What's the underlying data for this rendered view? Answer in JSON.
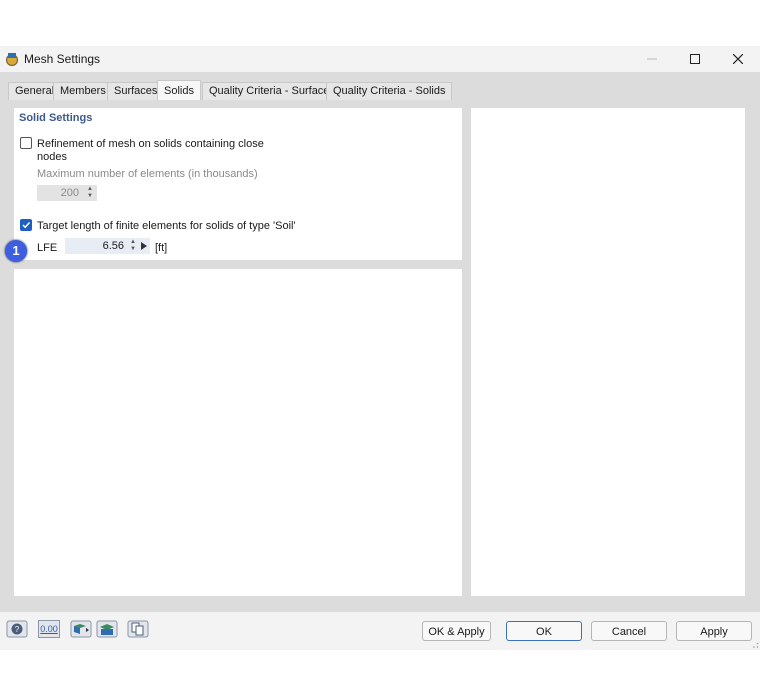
{
  "window": {
    "title": "Mesh Settings"
  },
  "tabs": [
    {
      "label": "General"
    },
    {
      "label": "Members"
    },
    {
      "label": "Surfaces"
    },
    {
      "label": "Solids"
    },
    {
      "label": "Quality Criteria - Surfaces"
    },
    {
      "label": "Quality Criteria - Solids"
    }
  ],
  "active_tab": "Solids",
  "solid_settings": {
    "title": "Solid Settings",
    "refinement": {
      "label_line1": "Refinement of mesh on solids containing close",
      "label_line2": "nodes",
      "checked": false
    },
    "max_elements": {
      "label": "Maximum number of elements (in thousands)",
      "value": "200"
    },
    "target_length": {
      "label": "Target length of finite elements for solids of type 'Soil'",
      "checked": true
    },
    "lfe": {
      "label": "LFE",
      "value": "6.56",
      "unit": "[ft]"
    }
  },
  "badge": "1",
  "footer": {
    "ok_apply": "OK & Apply",
    "ok": "OK",
    "cancel": "Cancel",
    "apply": "Apply",
    "units_icon_text": "0.00"
  }
}
